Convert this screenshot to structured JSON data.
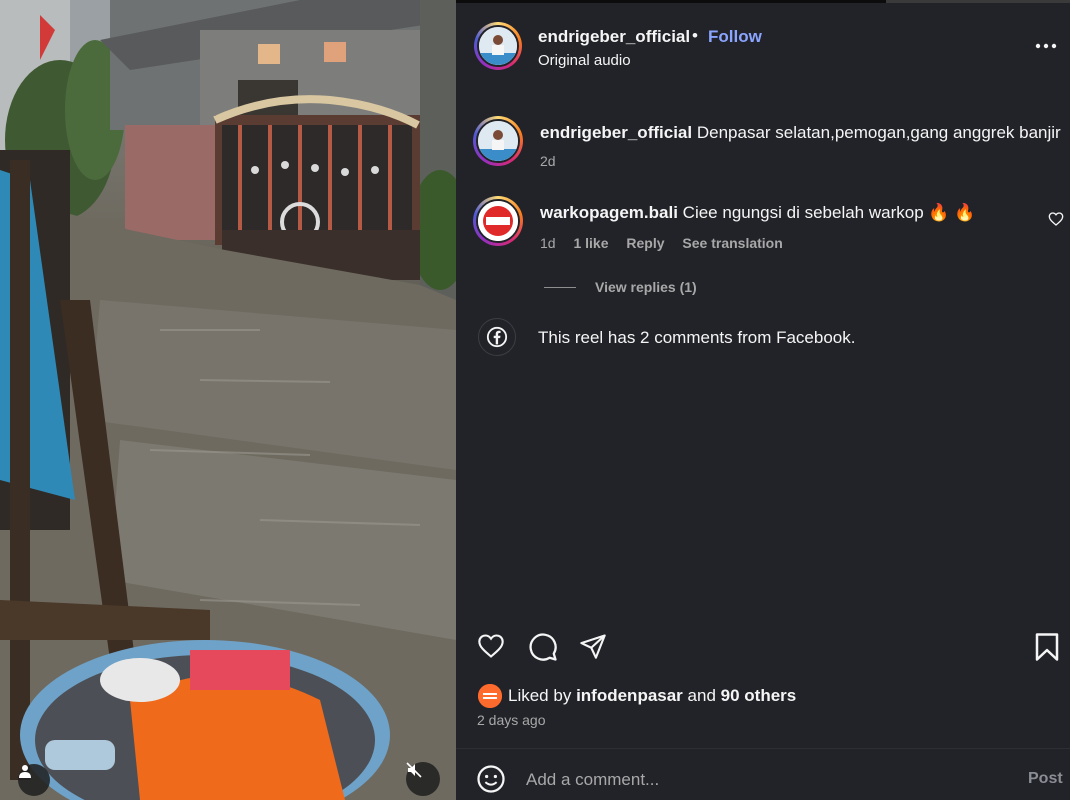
{
  "post": {
    "author": "endrigeber_official",
    "separator": "•",
    "follow_label": "Follow",
    "audio": "Original audio"
  },
  "caption": {
    "user": "endrigeber_official",
    "text": "Denpasar selatan,pemogan,gang anggrek banjir",
    "time": "2d"
  },
  "comments": [
    {
      "user": "warkopagem.bali",
      "text": "Ciee ngungsi di sebelah warkop 🔥 🔥",
      "time": "1d",
      "likes": "1 like",
      "reply_label": "Reply",
      "translate_label": "See translation",
      "view_replies": "View replies (1)"
    }
  ],
  "facebook_note": "This reel has 2 comments from Facebook.",
  "likes": {
    "prefix": "Liked by",
    "user": "infodenpasar",
    "and": "and",
    "others": "90 others"
  },
  "posted_ago": "2 days ago",
  "composer": {
    "placeholder": "Add a comment...",
    "post_label": "Post"
  },
  "icons": {
    "more": "more-horizontal-icon",
    "like": "heart-icon",
    "comment": "comment-icon",
    "share": "send-icon",
    "save": "bookmark-icon",
    "emoji": "emoji-icon",
    "facebook": "facebook-icon",
    "mute": "mute-icon",
    "user": "user-icon"
  },
  "colors": {
    "panel_bg": "#212328",
    "follow": "#8aa4ff",
    "muted_text": "#a8a8a8"
  }
}
